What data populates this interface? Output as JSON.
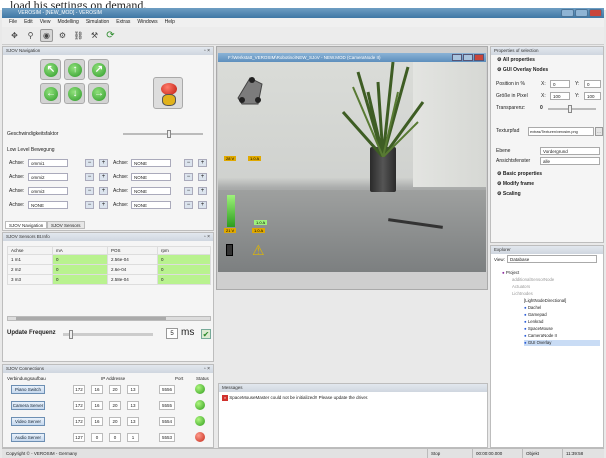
{
  "caption_text": "load his settings on demand.",
  "window": {
    "title": "VEROSIM - [NEW_MOD] - VEROSIM"
  },
  "menu": [
    "File",
    "Edit",
    "View",
    "Modelling",
    "Simulation",
    "Extras",
    "Windows",
    "Help"
  ],
  "navigation": {
    "title": "SJOV Navigation",
    "speed_label": "Geschwindigkeitsfaktor",
    "low_level_label": "Low Level Bewegung",
    "rows": [
      {
        "left_label": "Achse:",
        "left_value": "ommi1",
        "right_label": "Achse:",
        "right_value": "NONE"
      },
      {
        "left_label": "Achse:",
        "left_value": "ommi2",
        "right_label": "Achse:",
        "right_value": "NONE"
      },
      {
        "left_label": "Achse:",
        "left_value": "ommi3",
        "right_label": "Achse:",
        "right_value": "NONE"
      },
      {
        "left_label": "Achse:",
        "left_value": "NONE",
        "right_label": "Achse:",
        "right_value": "NONE"
      }
    ],
    "tabs": [
      "SJOV Navigation",
      "SJOV Sensors"
    ]
  },
  "sensors": {
    "title": "SJOV Sensors Bt.Info",
    "columns": [
      "Achse",
      "mA",
      "POS",
      "rpm"
    ],
    "rows": [
      {
        "achse": "1 m1",
        "ma": "0",
        "pos": "2.56e-04",
        "rpm": "0"
      },
      {
        "achse": "2 m2",
        "ma": "0",
        "pos": "2.6e-04",
        "rpm": "0"
      },
      {
        "achse": "3 m3",
        "ma": "0",
        "pos": "2.58e-04",
        "rpm": "0"
      }
    ],
    "update_label": "Update Frequenz",
    "update_value": "5",
    "update_unit": "ms"
  },
  "connections": {
    "title": "SJOV Connections",
    "columns": [
      "Verbindungsaufbau",
      "IP Addresse",
      "Port",
      "Status"
    ],
    "rows": [
      {
        "button": "Piano Switch",
        "ip": [
          "172",
          "16",
          "20",
          "13"
        ],
        "port": "5556",
        "status": "green"
      },
      {
        "button": "Camera Server",
        "ip": [
          "172",
          "16",
          "20",
          "13"
        ],
        "port": "5555",
        "status": "green"
      },
      {
        "button": "Video Server",
        "ip": [
          "172",
          "16",
          "20",
          "13"
        ],
        "port": "5554",
        "status": "green"
      },
      {
        "button": "Audio Server",
        "ip": [
          "127",
          "0",
          "0",
          "1"
        ],
        "port": "5553",
        "status": "red"
      }
    ]
  },
  "camera": {
    "title": "F:\\Werkstatt_VEROSIM\\Robotino\\NEW_SJoV - NEW.MOD (CameraNode II)",
    "overlays": [
      "28 V",
      "1.0 A",
      "1.0 A",
      "21 V",
      "1.0 A"
    ]
  },
  "messages": {
    "title": "Messages",
    "text": "SpaceMouseMaster could not be initialized!! Please update the driver."
  },
  "properties": {
    "title": "Properties of selection",
    "all_label": "All properties",
    "section": "GUI Overlay Nodes",
    "position_label": "Position in %",
    "position_x": "0",
    "position_y": "0",
    "size_label": "Größe in Pixel",
    "size_x": "100",
    "size_y": "100",
    "transparency_label": "Transparenz:",
    "transparency_value": "0",
    "texture_label": "Texturpfad",
    "texture_value": "extras/Texturen/verosim.png",
    "ebene_label": "Ebene",
    "ebene_value": "Vordergrund",
    "ansicht_label": "Ansichtsfenster",
    "ansicht_value": "alle",
    "basic": "Basic properties",
    "modify": "Modify frame",
    "scaling": "Scaling"
  },
  "explorer": {
    "title": "Explorer",
    "view_label": "View:",
    "view_value": "Database",
    "items": [
      "Project",
      "additionalSensorNode",
      "Actuators",
      "Lichtnodes",
      "[LightNodeDirectional]",
      "Dachel",
      "Gamepad",
      "Lenkrad",
      "SpaceMouse",
      "CameraNode II",
      "GUI Overlay"
    ]
  },
  "status_bar": {
    "copyright": "Copyright © - VEROSIM - Germany",
    "state": "Stop",
    "time": "00:00:00.000",
    "object": "Objekt",
    "clock": "11:39:58"
  }
}
